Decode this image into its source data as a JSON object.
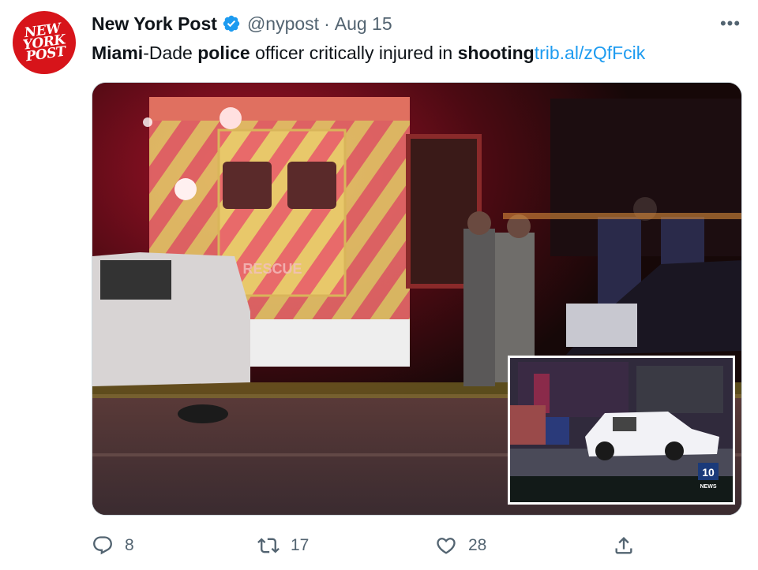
{
  "author": {
    "name": "New York Post",
    "handle": "@nypost",
    "separator": "·",
    "date": "Aug 15",
    "avatar_text": "NEW\nYORK\nPOST",
    "verified_icon": "verified-badge-icon"
  },
  "tweet": {
    "parts": [
      {
        "text": "Miami",
        "bold": true
      },
      {
        "text": "-Dade ",
        "bold": false
      },
      {
        "text": "police",
        "bold": true
      },
      {
        "text": " officer critically injured in ",
        "bold": false
      },
      {
        "text": "shooting",
        "bold": true
      }
    ],
    "link": "trib.al/zQfFcik"
  },
  "media": {
    "inset_badge": "10",
    "inset_badge_sub": "NEWS",
    "ambulance_text": "RESCUE"
  },
  "actions": {
    "reply_count": "8",
    "retweet_count": "17",
    "like_count": "28"
  },
  "more_label": "•••",
  "colors": {
    "link": "#1d9bf0",
    "muted": "#536471",
    "brand": "#d7141a",
    "verified": "#1d9bf0"
  }
}
